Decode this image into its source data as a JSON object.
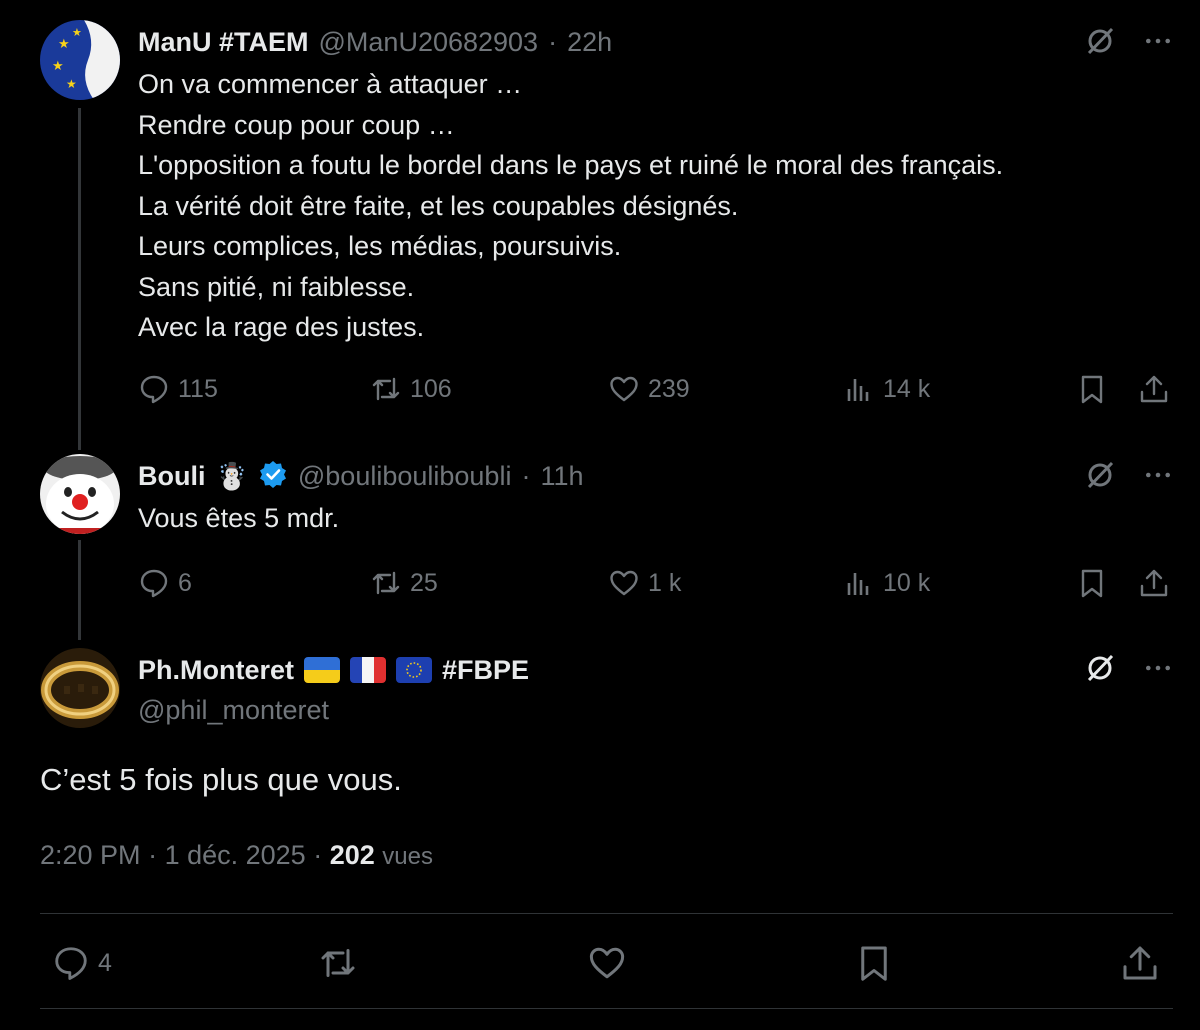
{
  "tweets": [
    {
      "name": "ManU #TAEM",
      "handle": "@ManU20682903",
      "time": "22h",
      "lines": [
        "On va commencer à attaquer …",
        "Rendre coup pour coup …",
        "L'opposition a foutu le bordel dans le pays et ruiné le moral des français.",
        "La vérité doit être faite, et les coupables désignés.",
        "Leurs complices, les médias, poursuivis.",
        "Sans pitié, ni faiblesse.",
        "Avec la rage des justes."
      ],
      "replies": "115",
      "reposts": "106",
      "likes": "239",
      "views": "14 k"
    },
    {
      "name": "Bouli",
      "emoji": "☃️",
      "handle": "@boulibouliboubli",
      "time": "11h",
      "lines": [
        "Vous êtes 5 mdr."
      ],
      "replies": "6",
      "reposts": "25",
      "likes": "1 k",
      "views": "10 k"
    }
  ],
  "main_tweet": {
    "name": "Ph.Monteret",
    "hashtag": "#FBPE",
    "handle": "@phil_monteret",
    "text": "C’est 5 fois plus que vous.",
    "time": "2:20 PM",
    "date": "1 déc. 2025",
    "views_count": "202",
    "views_label": "vues",
    "replies": "4"
  },
  "colors": {
    "background": "#000000",
    "text": "#e7e9ea",
    "muted": "#71767b",
    "verified": "#1d9bf0"
  }
}
